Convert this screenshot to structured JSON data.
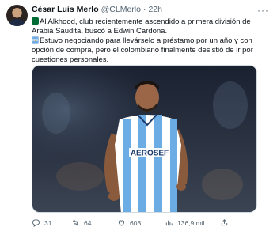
{
  "author": {
    "name": "César Luis Merlo",
    "handle": "@CLMerlo",
    "separator": "·",
    "time": "22h"
  },
  "tweet": {
    "line1": "Al Alkhood, club recientemente ascendido a primera división de Arabia Saudita, buscó a Edwin Cardona.",
    "line2": "Estuvo negociando para llevárselo a préstamo por un año y con opción de compra, pero el colombiano finalmente desistió de ir por cuestiones personales."
  },
  "media": {
    "jersey_text": "AEROSEF",
    "icon": "photo-of-player"
  },
  "actions": {
    "replies": "31",
    "retweets": "64",
    "likes": "603",
    "views": "136,9 mil"
  },
  "icons": {
    "more": "more-icon",
    "reply": "reply-icon",
    "retweet": "retweet-icon",
    "like": "heart-icon",
    "views": "views-icon",
    "share": "share-icon"
  },
  "colors": {
    "text": "#0f1419",
    "muted": "#536471",
    "jersey_blue": "#6cace4"
  }
}
